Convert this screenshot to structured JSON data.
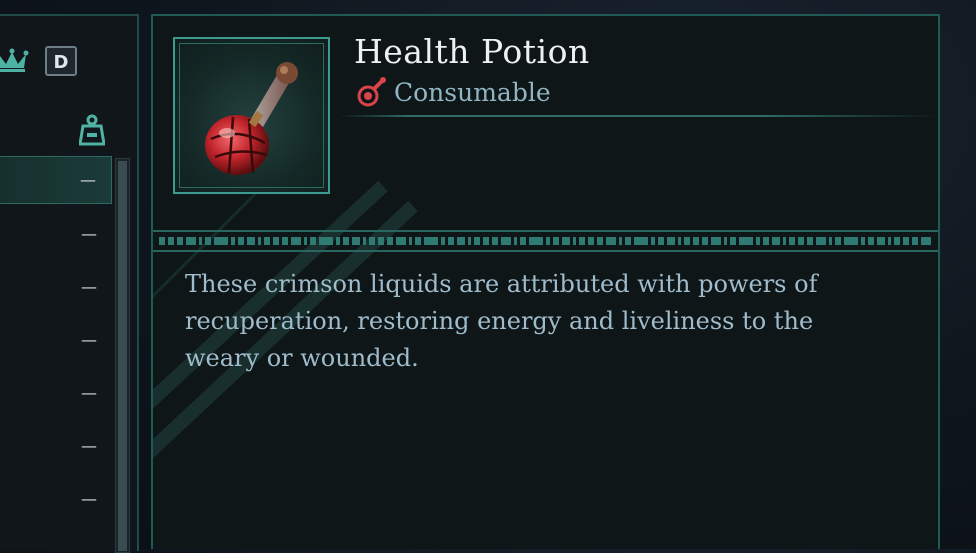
{
  "inventory": {
    "key_hint": "D",
    "rows": [
      {
        "value": "—",
        "selected": true
      },
      {
        "value": "—",
        "selected": false
      },
      {
        "value": "—",
        "selected": false
      },
      {
        "value": "—",
        "selected": false
      },
      {
        "value": "—",
        "selected": false
      },
      {
        "value": "—",
        "selected": false
      },
      {
        "value": "—",
        "selected": false
      }
    ]
  },
  "item": {
    "name": "Health Potion",
    "category": "Consumable",
    "description": "These crimson liquids are attributed with powers of recuperation, restoring energy and liveliness to the weary or wounded.",
    "icon": "health-potion-icon",
    "category_icon": "flask-icon"
  },
  "colors": {
    "accent": "#3c9a8f",
    "category": "#8fb5c2",
    "category_icon": "#d8454a",
    "description": "#9fbccc"
  }
}
